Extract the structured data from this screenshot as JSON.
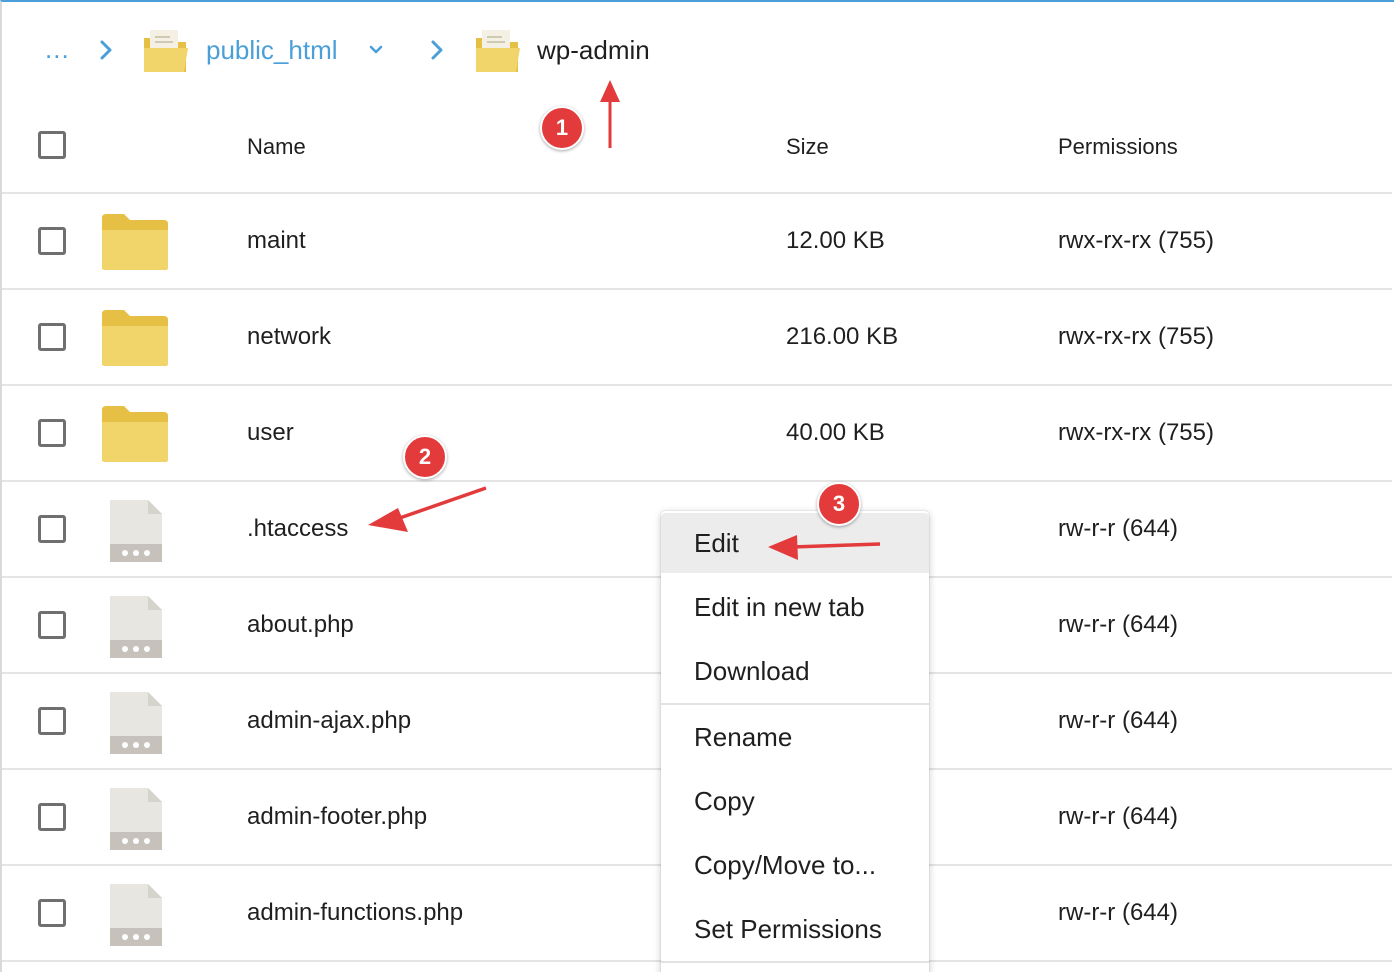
{
  "breadcrumb": {
    "ellipsis": "...",
    "parent": "public_html",
    "current": "wp-admin"
  },
  "columns": {
    "name": "Name",
    "size": "Size",
    "permissions": "Permissions"
  },
  "rows": [
    {
      "type": "folder",
      "name": "maint",
      "size": "12.00 KB",
      "permissions": "rwx-rx-rx (755)"
    },
    {
      "type": "folder",
      "name": "network",
      "size": "216.00 KB",
      "permissions": "rwx-rx-rx (755)"
    },
    {
      "type": "folder",
      "name": "user",
      "size": "40.00 KB",
      "permissions": "rwx-rx-rx (755)"
    },
    {
      "type": "file",
      "name": ".htaccess",
      "size": "",
      "permissions": "rw-r-r (644)"
    },
    {
      "type": "file",
      "name": "about.php",
      "size": "",
      "permissions": "rw-r-r (644)"
    },
    {
      "type": "file",
      "name": "admin-ajax.php",
      "size": "",
      "permissions": "rw-r-r (644)"
    },
    {
      "type": "file",
      "name": "admin-footer.php",
      "size": "",
      "permissions": "rw-r-r (644)"
    },
    {
      "type": "file",
      "name": "admin-functions.php",
      "size": "",
      "permissions": "rw-r-r (644)"
    }
  ],
  "context_menu": {
    "items": [
      "Edit",
      "Edit in new tab",
      "Download",
      "Rename",
      "Copy",
      "Copy/Move to...",
      "Set Permissions"
    ]
  },
  "annotations": {
    "badges": [
      "1",
      "2",
      "3"
    ]
  },
  "colors": {
    "accent": "#4a9fd8",
    "folder": "#f1d46a",
    "folder_tab": "#e6bf45",
    "annotation": "#e33b3b"
  },
  "icons": {
    "breadcrumb_separator": "chevron-right-icon",
    "folder": "folder-icon",
    "file": "file-icon"
  }
}
